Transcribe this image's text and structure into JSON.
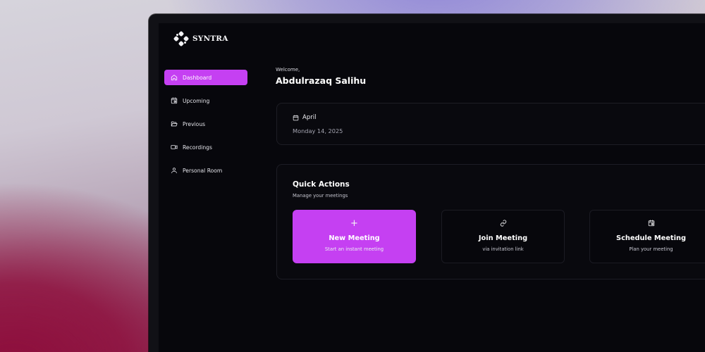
{
  "app": {
    "name": "SYNTRA"
  },
  "sidebar": {
    "items": [
      {
        "label": "Dashboard",
        "icon": "home-icon",
        "active": true
      },
      {
        "label": "Upcoming",
        "icon": "calendar-clock-icon",
        "active": false
      },
      {
        "label": "Previous",
        "icon": "folder-open-icon",
        "active": false
      },
      {
        "label": "Recordings",
        "icon": "video-icon",
        "active": false
      },
      {
        "label": "Personal Room",
        "icon": "user-icon",
        "active": false
      }
    ]
  },
  "welcome": {
    "greeting": "Welcome,",
    "name": "Abdulrazaq Salihu"
  },
  "date_card": {
    "month": "April",
    "date": "Monday 14, 2025",
    "icon": "calendar-icon"
  },
  "quick_actions": {
    "title": "Quick Actions",
    "subtitle": "Manage your meetings",
    "actions": [
      {
        "title": "New Meeting",
        "subtitle": "Start an instant meeting",
        "icon": "plus-icon",
        "glyph": "+"
      },
      {
        "title": "Join Meeting",
        "subtitle": "via invitation link",
        "icon": "link-icon"
      },
      {
        "title": "Schedule Meeting",
        "subtitle": "Plan your meeting",
        "icon": "calendar-clock-icon"
      }
    ]
  },
  "colors": {
    "accent": "#c540f2",
    "screen_background": "#07070c",
    "card_border": "#1d1d25"
  }
}
